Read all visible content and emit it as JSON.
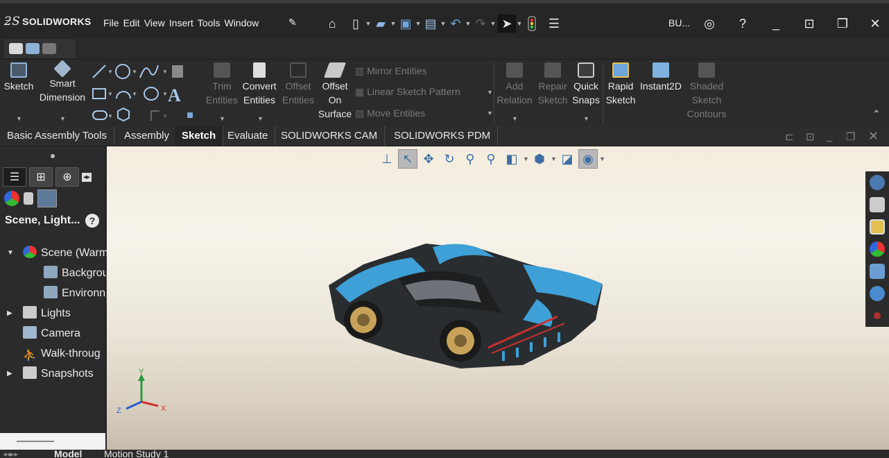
{
  "app": {
    "logo": "SOLIDWORKS",
    "menus": [
      "File",
      "Edit",
      "View",
      "Insert",
      "Tools",
      "Window"
    ],
    "search_abbrev": "BU..."
  },
  "command_manager": {
    "sketch": "Sketch",
    "smart_dimension": [
      "Smart",
      "Dimension"
    ],
    "trim": [
      "Trim",
      "Entities"
    ],
    "convert": [
      "Convert",
      "Entities"
    ],
    "offset": [
      "Offset",
      "Entities"
    ],
    "offset_surface": [
      "Offset",
      "On",
      "Surface"
    ],
    "mirror": "Mirror Entities",
    "linear_pattern": "Linear Sketch Pattern",
    "move": "Move Entities",
    "add_relation": [
      "Add",
      "Relation"
    ],
    "repair": [
      "Repair",
      "Sketch"
    ],
    "quick_snaps": [
      "Quick",
      "Snaps"
    ],
    "rapid_sketch": [
      "Rapid",
      "Sketch"
    ],
    "instant2d": "Instant2D",
    "shaded": [
      "Shaded",
      "Sketch",
      "Contours"
    ]
  },
  "tabs": [
    "Basic Assembly Tools",
    "Assembly",
    "Sketch",
    "Evaluate",
    "SOLIDWORKS CAM",
    "SOLIDWORKS PDM"
  ],
  "active_tab": "Sketch",
  "pane": {
    "title": "Scene, Light...",
    "help": "?",
    "items": [
      {
        "label": "Scene (Warm"
      },
      {
        "label": "Backgrou"
      },
      {
        "label": "Environn"
      },
      {
        "label": "Lights"
      },
      {
        "label": "Camera"
      },
      {
        "label": "Walk-throug"
      },
      {
        "label": "Snapshots"
      }
    ]
  },
  "triad": {
    "x": "X",
    "y": "Y",
    "z": "Z"
  },
  "bottom_tabs": [
    "Model",
    "Motion Study 1"
  ],
  "colors": {
    "car_body": "#3ea0d6",
    "car_dark": "#2a2d30",
    "accent_red": "#c8302f",
    "rim": "#c9a25a"
  }
}
